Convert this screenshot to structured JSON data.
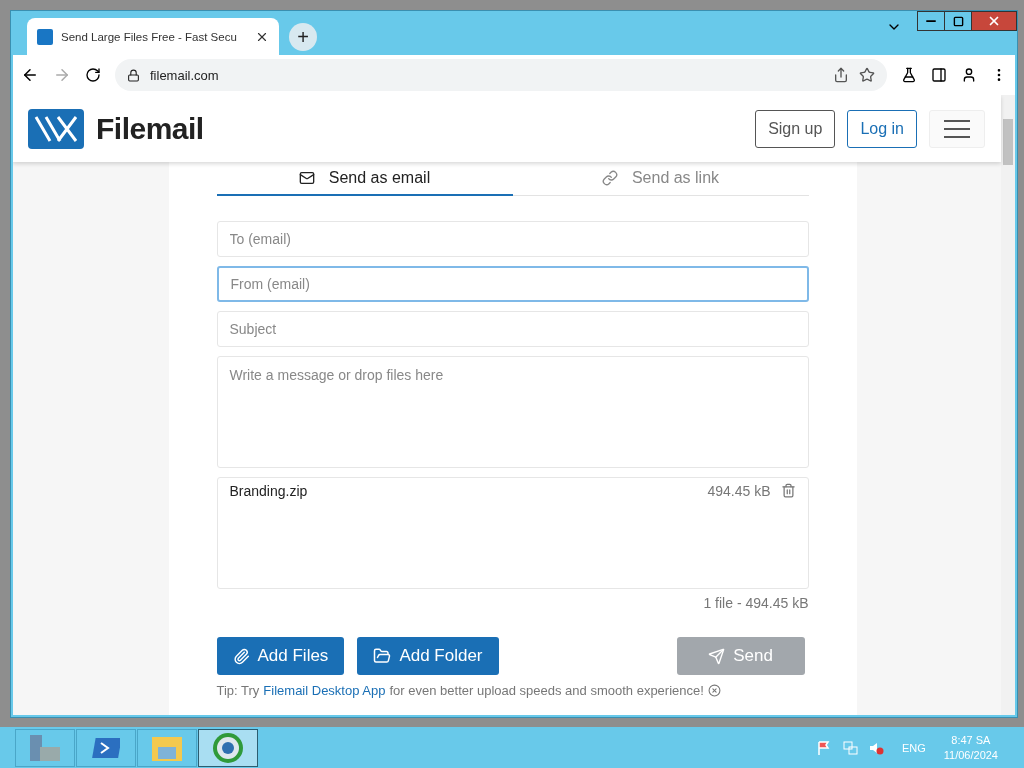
{
  "browser": {
    "tabs": [
      {
        "title": "Send Large Files Free - Fast Secu",
        "selected": true
      }
    ],
    "new_tab": "+",
    "address": "filemail.com"
  },
  "site": {
    "logo": "Filemail",
    "nav_buttons": [
      {
        "label": "Sign up"
      },
      {
        "label": "Log in"
      }
    ],
    "send_tabs": [
      {
        "label": "Send as email",
        "kind": "email",
        "selected": true
      },
      {
        "label": "Send as link",
        "kind": "link",
        "selected": false
      }
    ],
    "fields": [
      {
        "placeholder": "To (email)",
        "focused": false
      },
      {
        "placeholder": "From (email)",
        "focused": true
      },
      {
        "placeholder": "Subject",
        "focused": false
      }
    ],
    "message": {
      "placeholder": "Write a message or drop files here"
    },
    "attachment": {
      "name": "Branding.zip",
      "size": "494.45 kB"
    },
    "summary": "1 file - 494.45 kB",
    "buttons": [
      {
        "label": "Add Files",
        "kind": "files",
        "disabled": false
      },
      {
        "label": "Add Folder",
        "kind": "folder",
        "disabled": false
      },
      {
        "label": "Send",
        "kind": "send",
        "disabled": true
      }
    ],
    "tip": {
      "before": "Tip: Try",
      "link": "Filemail Desktop App",
      "after": "for even better upload speeds and smooth experience!"
    }
  },
  "taskbar": {
    "apps": [
      {
        "kind": "server",
        "selected": false
      },
      {
        "kind": "shell",
        "selected": false
      },
      {
        "kind": "folder",
        "selected": false
      },
      {
        "kind": "browser",
        "selected": true
      }
    ],
    "language": "ENG",
    "time": "8:47 SA",
    "date": "11/06/2024"
  }
}
